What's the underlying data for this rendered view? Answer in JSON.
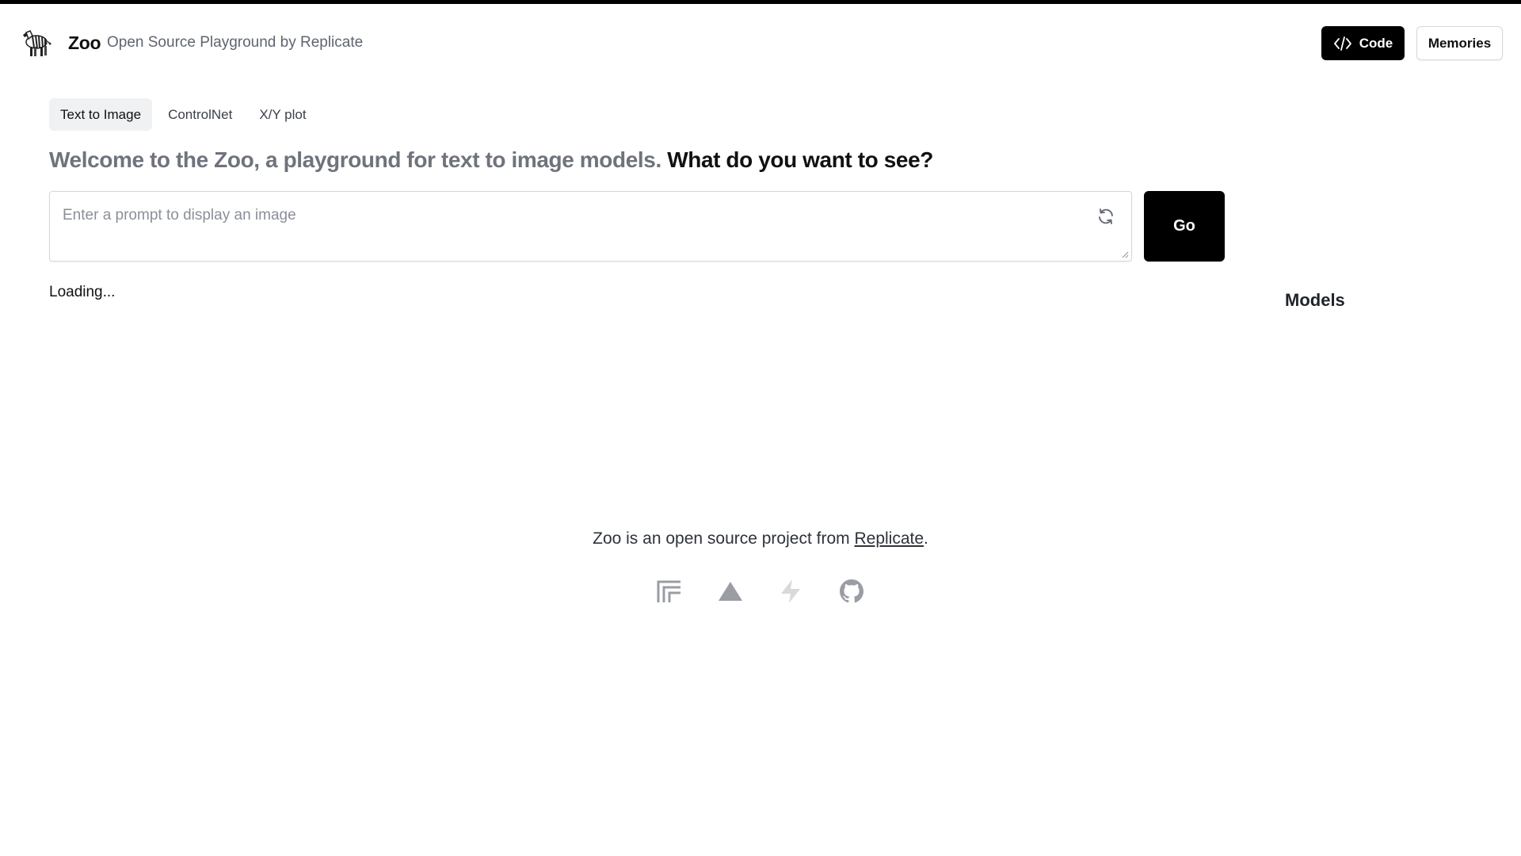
{
  "header": {
    "brand_name": "Zoo",
    "tagline": "Open Source Playground by Replicate",
    "code_label": "Code",
    "memories_label": "Memories"
  },
  "tabs": [
    {
      "label": "Text to Image",
      "active": true
    },
    {
      "label": "ControlNet",
      "active": false
    },
    {
      "label": "X/Y plot",
      "active": false
    }
  ],
  "headline": {
    "muted": "Welcome to the Zoo, a playground for text to image models.",
    "strong": "What do you want to see?"
  },
  "prompt": {
    "placeholder": "Enter a prompt to display an image",
    "value": "",
    "go_label": "Go"
  },
  "status": {
    "loading": "Loading..."
  },
  "sidebar": {
    "models_heading": "Models"
  },
  "footer": {
    "text_before": "Zoo is an open source project from",
    "link_label": "Replicate",
    "text_after": ".",
    "icons": [
      "replicate-icon",
      "vercel-icon",
      "supabase-icon",
      "github-icon"
    ]
  },
  "colors": {
    "accent": "#000000",
    "muted_text": "#6e737c",
    "icon_gray": "#9a9da3"
  }
}
